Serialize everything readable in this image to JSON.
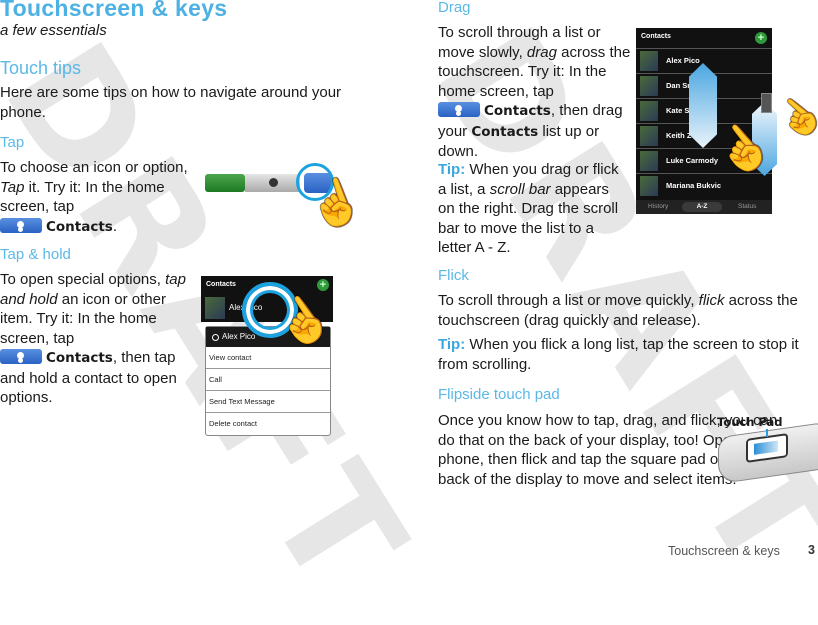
{
  "watermark": "DRAFT",
  "colors": {
    "heading": "#4eb1e3",
    "tip": "#3aa7de",
    "ring": "#1da2e0",
    "contacts_button": "#2a62c4",
    "phone_button": "#1e7a23"
  },
  "page": {
    "title": "Touchscreen & keys",
    "subtitle": "a few essentials",
    "section_title": "Touch tips",
    "intro": "Here are some tips on how to navigate around your phone."
  },
  "tap": {
    "heading": "Tap",
    "text_a": "To choose an icon or option, ",
    "text_em": "Tap",
    "text_b": " it. Try it: In the home screen, tap",
    "keyword": "Contacts",
    "text_end": "."
  },
  "tap_hold": {
    "heading": "Tap & hold",
    "text_a": "To open special options, ",
    "text_em": "tap and hold",
    "text_b": " an icon or other item. Try it: In the home screen, tap",
    "keyword": "Contacts",
    "text_end": ", then tap and hold a contact to open options."
  },
  "tap_hold_screen": {
    "header": "Contacts",
    "add_icon": "+",
    "contact": "Alex Pico",
    "menu_title": "Alex Pico",
    "menu_items": [
      "View contact",
      "Call",
      "Send Text Message",
      "Delete contact"
    ]
  },
  "drag": {
    "heading": "Drag",
    "text_a": "To scroll through a list or move slowly, ",
    "text_em": "drag",
    "text_b": " across the touchscreen. Try it: In the home screen, tap",
    "keyword": "Contacts",
    "text_c": ", then drag your ",
    "keyword2": "Contacts",
    "text_end": " list up or down.",
    "tip_label": "Tip:",
    "tip_a": " When you drag or flick a list, a ",
    "tip_em": "scroll bar",
    "tip_b": " appears on the right. Drag the scroll bar to move the list to a letter A - Z."
  },
  "drag_screen": {
    "header": "Contacts",
    "add_icon": "+",
    "contacts": [
      "Alex Pico",
      "Dan Sm",
      "Kate Sh",
      "Keith Z",
      "Luke Carmody",
      "Mariana Bukvic"
    ],
    "tabs": [
      "History",
      "A-Z",
      "Status"
    ],
    "selected_tab": "A-Z"
  },
  "flick": {
    "heading": "Flick",
    "text_a": "To scroll through a list or move quickly, ",
    "text_em": "flick",
    "text_b": " across the touchscreen (drag quickly and release).",
    "tip_label": "Tip:",
    "tip_text": " When you flick a long list, tap the screen to stop it from scrolling."
  },
  "flipside": {
    "heading": "Flipside touch pad",
    "text": "Once you know how to tap, drag, and flick, you can do that on the back of your display, too! Open your phone, then flick and tap the square pad on the back of the display to move and select items.",
    "label": "Touch Pad"
  },
  "footer": {
    "section": "Touchscreen & keys",
    "page_number": "3"
  }
}
